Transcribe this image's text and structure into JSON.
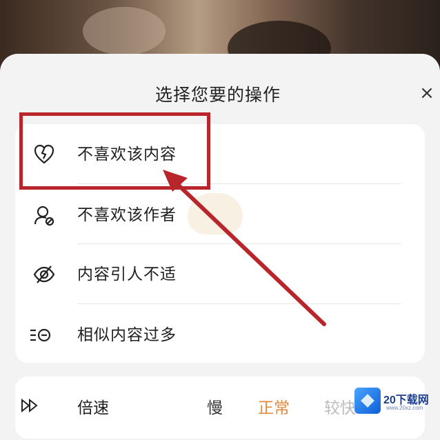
{
  "sheet": {
    "title": "选择您要的操作",
    "close_glyph": "×"
  },
  "options": [
    {
      "label": "不喜欢该内容",
      "icon": "broken-heart-icon"
    },
    {
      "label": "不喜欢该作者",
      "icon": "block-user-icon"
    },
    {
      "label": "内容引人不适",
      "icon": "hidden-eye-icon"
    },
    {
      "label": "相似内容过多",
      "icon": "list-minus-icon"
    }
  ],
  "speed": {
    "label": "倍速",
    "icon": "fast-forward-icon",
    "options": [
      "慢",
      "正常",
      "较快"
    ],
    "selected": "正常"
  },
  "watermark": {
    "site_name": "20下载网",
    "site_url": "www.20xz.com"
  },
  "colors": {
    "highlight": "#b8262b",
    "selected_speed": "#e08a3c"
  }
}
